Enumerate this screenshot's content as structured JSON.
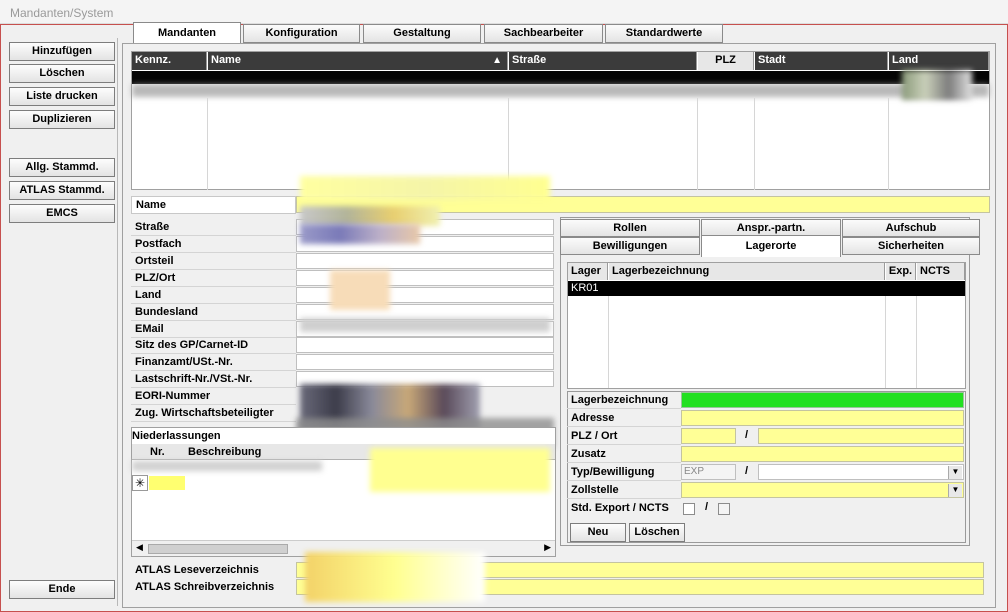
{
  "window": {
    "title": "Mandanten/System"
  },
  "toolbar": {
    "add": "Hinzufügen",
    "delete": "Löschen",
    "print_list": "Liste drucken",
    "duplicate": "Duplizieren",
    "general_master": "Allg. Stammd.",
    "atlas_master": "ATLAS Stammd.",
    "emcs": "EMCS",
    "end": "Ende"
  },
  "tabs": [
    "Mandanten",
    "Konfiguration",
    "Gestaltung",
    "Sachbearbeiter",
    "Standardwerte"
  ],
  "client_table": {
    "columns": [
      "Kennz.",
      "Name",
      "Straße",
      "PLZ",
      "Stadt",
      "Land"
    ],
    "sort_icon": "triangle-up-icon"
  },
  "form": {
    "name_label": "Name",
    "fields": [
      "Straße",
      "Postfach",
      "Ortsteil",
      "PLZ/Ort",
      "Land",
      "Bundesland",
      "EMail",
      "Sitz des GP/Carnet-ID",
      "Finanzamt/USt.-Nr.",
      "Lastschrift-Nr./VSt.-Nr.",
      "EORI-Nummer",
      "Zug. Wirtschaftsbeteiligter"
    ]
  },
  "branches": {
    "title": "Niederlassungen",
    "columns": [
      "Nr.",
      "Beschreibung"
    ],
    "new_row_marker": "✳"
  },
  "subtabs": {
    "row1": [
      "Rollen",
      "Anspr.-partn.",
      "Aufschub"
    ],
    "row2": [
      "Bewilligungen",
      "Lagerorte",
      "Sicherheiten"
    ]
  },
  "warehouse": {
    "columns": [
      "Lager",
      "Lagerbezeichnung",
      "Exp.",
      "NCTS"
    ],
    "rows": [
      {
        "code": "KR01",
        "name": "",
        "exp": "",
        "ncts": ""
      }
    ],
    "labels": {
      "designation": "Lagerbezeichnung",
      "address": "Adresse",
      "zip_city": "PLZ / Ort",
      "addition": "Zusatz",
      "type_permit": "Typ/Bewilligung",
      "customs_office": "Zollstelle",
      "std_export": "Std. Export / NCTS"
    },
    "type_value": "EXP",
    "slash": "/",
    "new_button": "Neu",
    "delete_button": "Löschen"
  },
  "atlas": {
    "read_dir": "ATLAS Leseverzeichnis",
    "write_dir": "ATLAS Schreibverzeichnis"
  },
  "colors": {
    "field_yellow": "#ffff96",
    "field_green": "#22e020",
    "header_dark": "#3b3b3b",
    "selection": "#000000"
  }
}
